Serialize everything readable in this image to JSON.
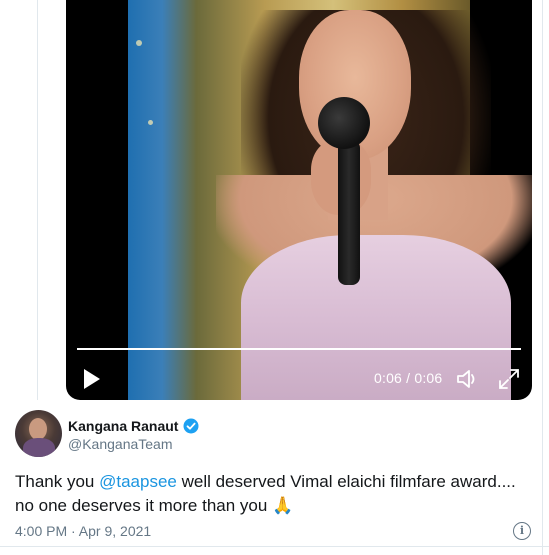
{
  "video": {
    "current_time": "0:06",
    "separator": " / ",
    "duration": "0:06",
    "progress": 1.0
  },
  "tweet": {
    "author_name": "Kangana Ranaut",
    "author_handle": "@KanganaTeam",
    "verified": true,
    "text_before": "Thank you ",
    "mention": "@taapsee",
    "text_after": " well deserved Vimal elaichi filmfare award.... no one deserves it more than you ",
    "emoji": "🙏",
    "timestamp": "4:00 PM · Apr 9, 2021"
  },
  "icons": {
    "play": "play-icon",
    "volume": "volume-icon",
    "fullscreen": "fullscreen-icon",
    "verified": "verified-badge-icon",
    "info": "info-icon"
  },
  "colors": {
    "link": "#1b95e0",
    "verified": "#1da1f2",
    "secondary_text": "#657786"
  }
}
